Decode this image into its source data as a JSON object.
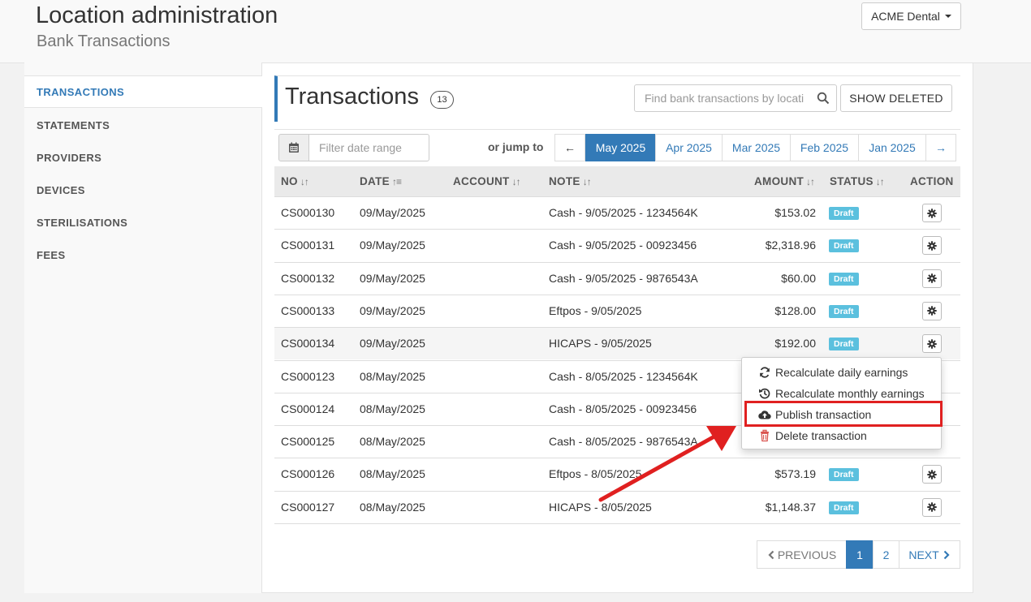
{
  "header": {
    "title": "Location administration",
    "subtitle": "Bank Transactions",
    "org_button": "ACME Dental"
  },
  "sidebar": {
    "items": [
      {
        "label": "TRANSACTIONS",
        "active": true
      },
      {
        "label": "STATEMENTS"
      },
      {
        "label": "PROVIDERS"
      },
      {
        "label": "DEVICES"
      },
      {
        "label": "STERILISATIONS"
      },
      {
        "label": "FEES"
      }
    ]
  },
  "main": {
    "title": "Transactions",
    "count": "13",
    "search_placeholder": "Find bank transactions by location",
    "show_deleted": "SHOW DELETED",
    "date_placeholder": "Filter date range",
    "jump_label": "or jump to",
    "prev_arrow": "←",
    "next_arrow": "→",
    "months": [
      "May 2025",
      "Apr 2025",
      "Mar 2025",
      "Feb 2025",
      "Jan 2025"
    ],
    "active_month": "May 2025"
  },
  "table": {
    "columns": [
      "NO",
      "DATE",
      "ACCOUNT",
      "NOTE",
      "AMOUNT",
      "STATUS",
      "ACTION"
    ],
    "rows": [
      {
        "no": "CS000130",
        "date": "09/May/2025",
        "account": "",
        "note": "Cash - 9/05/2025 - 1234564K",
        "amount": "$153.02",
        "status": "Draft"
      },
      {
        "no": "CS000131",
        "date": "09/May/2025",
        "account": "",
        "note": "Cash - 9/05/2025 - 00923456",
        "amount": "$2,318.96",
        "status": "Draft"
      },
      {
        "no": "CS000132",
        "date": "09/May/2025",
        "account": "",
        "note": "Cash - 9/05/2025 - 9876543A",
        "amount": "$60.00",
        "status": "Draft"
      },
      {
        "no": "CS000133",
        "date": "09/May/2025",
        "account": "",
        "note": "Eftpos - 9/05/2025",
        "amount": "$128.00",
        "status": "Draft"
      },
      {
        "no": "CS000134",
        "date": "09/May/2025",
        "account": "",
        "note": "HICAPS - 9/05/2025",
        "amount": "$192.00",
        "status": "Draft"
      },
      {
        "no": "CS000123",
        "date": "08/May/2025",
        "account": "",
        "note": "Cash - 8/05/2025 - 1234564K",
        "amount": "",
        "status": ""
      },
      {
        "no": "CS000124",
        "date": "08/May/2025",
        "account": "",
        "note": "Cash - 8/05/2025 - 00923456",
        "amount": "",
        "status": ""
      },
      {
        "no": "CS000125",
        "date": "08/May/2025",
        "account": "",
        "note": "Cash - 8/05/2025 - 9876543A",
        "amount": "",
        "status": ""
      },
      {
        "no": "CS000126",
        "date": "08/May/2025",
        "account": "",
        "note": "Eftpos - 8/05/2025",
        "amount": "$573.19",
        "status": "Draft"
      },
      {
        "no": "CS000127",
        "date": "08/May/2025",
        "account": "",
        "note": "HICAPS - 8/05/2025",
        "amount": "$1,148.37",
        "status": "Draft"
      }
    ]
  },
  "action_menu": {
    "items": [
      {
        "label": "Recalculate daily earnings",
        "icon": "refresh-icon"
      },
      {
        "label": "Recalculate monthly earnings",
        "icon": "history-icon"
      },
      {
        "label": "Publish transaction",
        "icon": "cloud-upload-icon",
        "highlighted": true
      },
      {
        "label": "Delete transaction",
        "icon": "trash-icon",
        "color": "#d9534f"
      }
    ]
  },
  "pagination": {
    "previous": "PREVIOUS",
    "pages": [
      "1",
      "2"
    ],
    "active_page": "1",
    "next": "NEXT"
  },
  "colors": {
    "primary": "#337ab7",
    "badge": "#5bc0de",
    "annotation": "#e02020",
    "danger": "#d9534f"
  }
}
